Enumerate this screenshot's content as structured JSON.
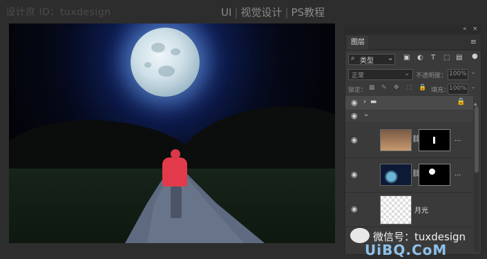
{
  "header": {
    "left_label": "设计庶 ID：tuxdesign",
    "right_items": [
      "UI",
      "视觉设计",
      "PS教程"
    ]
  },
  "panel": {
    "tab": "图层",
    "filter_label": "类型",
    "blend_mode": "正常",
    "opacity_label": "不透明度：",
    "opacity_value": "100%",
    "lock_label": "锁定：",
    "fill_label": "填充：",
    "fill_value": "100%",
    "layers": [
      {
        "kind": "group",
        "name": ""
      },
      {
        "kind": "group-expanded",
        "name": ""
      },
      {
        "kind": "smart",
        "name": "",
        "more": "..."
      },
      {
        "kind": "smart",
        "name": "",
        "more": "..."
      },
      {
        "kind": "transparent",
        "name": "月光"
      }
    ]
  },
  "watermark": {
    "wechat": "微信号：tuxdesign",
    "brand": "UiBQ.CoM"
  },
  "colors": {
    "accent": "#8ec0ea",
    "figure_jacket": "#e23a4a",
    "bg": "#2d2d2d"
  }
}
